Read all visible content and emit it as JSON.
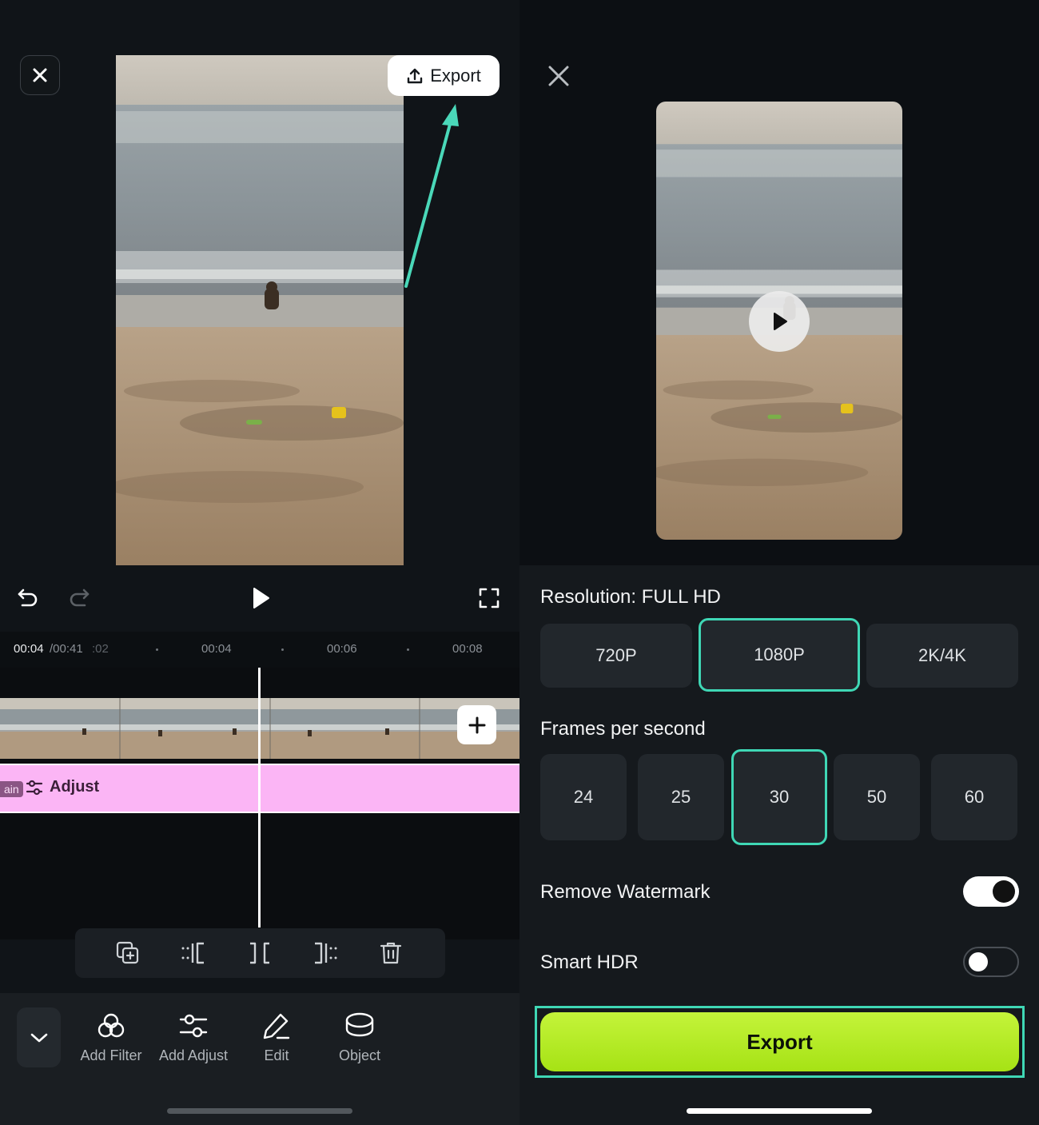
{
  "editor": {
    "export_label": "Export",
    "timeline": {
      "current_time": "00:04",
      "total_time": "/00:41",
      "tick_ghost": ":02",
      "ticks": [
        "00:04",
        "00:06",
        "00:08"
      ]
    },
    "adjust_track": {
      "main_tag": "ain",
      "label": "Adjust"
    },
    "toolbar": [
      {
        "label": "Add Filter",
        "icon": "filter-icon"
      },
      {
        "label": "Add Adjust",
        "icon": "sliders-icon"
      },
      {
        "label": "Edit",
        "icon": "pencil-icon"
      },
      {
        "label": "Object",
        "icon": "object-icon"
      }
    ],
    "edit_tools": [
      "duplicate-icon",
      "trim-start-icon",
      "split-icon",
      "trim-end-icon",
      "delete-icon"
    ]
  },
  "export_sheet": {
    "resolution_title": "Resolution: FULL HD",
    "resolutions": [
      {
        "label": "720P",
        "selected": false
      },
      {
        "label": "1080P",
        "selected": true
      },
      {
        "label": "2K/4K",
        "selected": false
      }
    ],
    "fps_title": "Frames per second",
    "fps": [
      {
        "label": "24",
        "selected": false
      },
      {
        "label": "25",
        "selected": false
      },
      {
        "label": "30",
        "selected": true
      },
      {
        "label": "50",
        "selected": false
      },
      {
        "label": "60",
        "selected": false
      }
    ],
    "remove_watermark": {
      "label": "Remove Watermark",
      "on": true
    },
    "smart_hdr": {
      "label": "Smart HDR",
      "on": false
    },
    "export_button": "Export"
  },
  "colors": {
    "accent": "#3fd7b5",
    "export_green": "#b5ec28",
    "adjust_pink": "#fbb5f5"
  }
}
